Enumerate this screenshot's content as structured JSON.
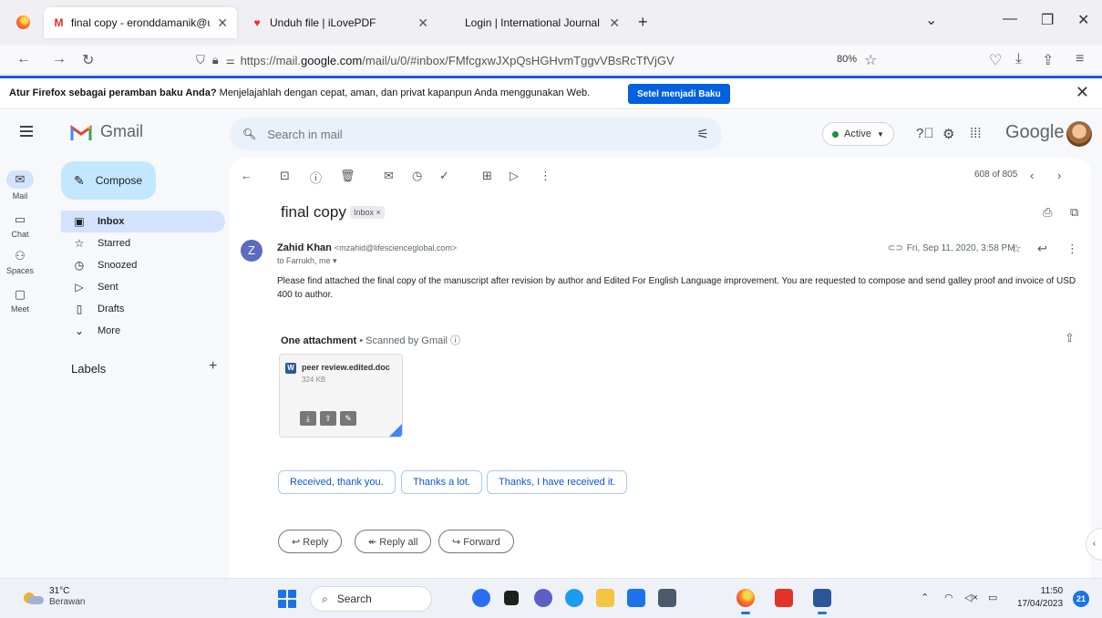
{
  "browser": {
    "tabs": [
      {
        "title": "final copy - eronddamanik@uni",
        "icon": "gmail-icon",
        "active": true
      },
      {
        "title": "Unduh file | iLovePDF",
        "icon": "ilovepdf-heart-icon",
        "active": false
      },
      {
        "title": "Login | International Journal of",
        "icon": "",
        "active": false
      }
    ],
    "url_prefix": "https://mail.",
    "url_domain": "google.com",
    "url_path": "/mail/u/0/#inbox/FMfcgxwJXpQsHGHvmTggvVBsRcTfVjGV",
    "zoom": "80%"
  },
  "notification": {
    "bold": "Atur Firefox sebagai peramban baku Anda?",
    "text": " Menjelajahlah dengan cepat, aman, dan privat kapanpun Anda menggunakan Web.",
    "button": "Setel menjadi Baku"
  },
  "gmail": {
    "logo_text": "Gmail",
    "search_placeholder": "Search in mail",
    "status": "Active",
    "google_text": "Google",
    "rail": [
      {
        "label": "Mail",
        "icon": "mail-icon"
      },
      {
        "label": "Chat",
        "icon": "chat-icon"
      },
      {
        "label": "Spaces",
        "icon": "spaces-icon"
      },
      {
        "label": "Meet",
        "icon": "meet-icon"
      }
    ],
    "compose": "Compose",
    "nav": [
      {
        "label": "Inbox",
        "icon": "inbox-icon"
      },
      {
        "label": "Starred",
        "icon": "star-icon"
      },
      {
        "label": "Snoozed",
        "icon": "clock-icon"
      },
      {
        "label": "Sent",
        "icon": "send-icon"
      },
      {
        "label": "Drafts",
        "icon": "draft-icon"
      },
      {
        "label": "More",
        "icon": "chevron-down-icon"
      }
    ],
    "labels_header": "Labels",
    "pager": "608 of 805",
    "message": {
      "subject": "final copy",
      "label_chip": "Inbox ×",
      "avatar_letter": "Z",
      "sender_name": "Zahid Khan",
      "sender_email": "<mzahid@lifescienceglobal.com>",
      "to": "to Farrukh, me ▾",
      "date": "Fri, Sep 11, 2020, 3:58 PM",
      "body": "Please find attached the final copy of the manuscript after revision by author and Edited For English Language improvement. You are requested to compose and send galley proof and invoice of USD 400 to author.",
      "attachments_title": "One attachment",
      "scanned": " • Scanned by Gmail ⓘ",
      "attachment": {
        "name": "peer review.edited.doc",
        "size": "324 KB"
      },
      "smart_replies": [
        "Received, thank you.",
        "Thanks a lot.",
        "Thanks, I have received it."
      ],
      "actions": {
        "reply": "Reply",
        "reply_all": "Reply all",
        "forward": "Forward"
      }
    }
  },
  "taskbar": {
    "temperature": "31°C",
    "weather": "Berawan",
    "search": "Search",
    "time": "11:50",
    "date": "17/04/2023",
    "notifications": "21"
  }
}
